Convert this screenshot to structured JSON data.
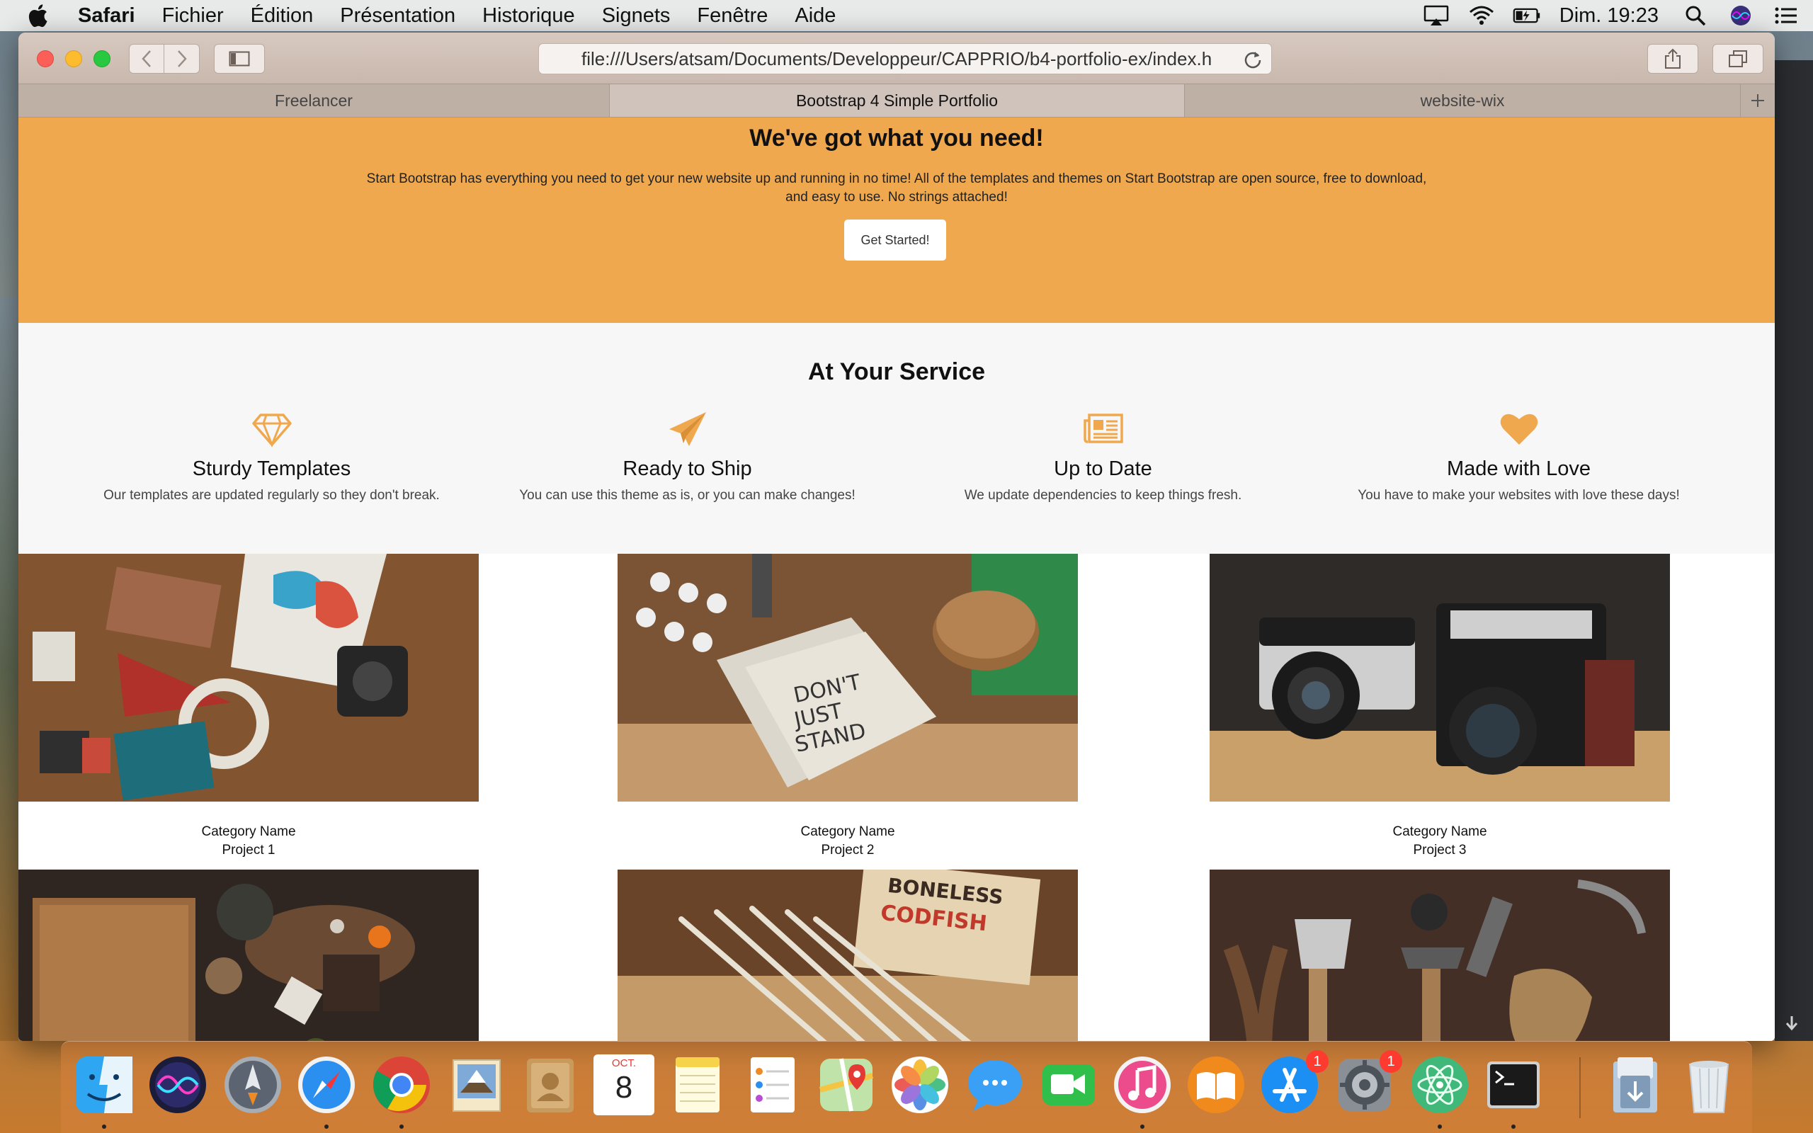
{
  "menubar": {
    "app_name": "Safari",
    "items": [
      "Fichier",
      "Édition",
      "Présentation",
      "Historique",
      "Signets",
      "Fenêtre",
      "Aide"
    ],
    "clock": "Dim. 19:23",
    "status_icons": [
      "airplay-icon",
      "wifi-icon",
      "battery-icon",
      "spotlight-icon",
      "siri-icon",
      "notification-center-icon"
    ]
  },
  "browser": {
    "url": "file:///Users/atsam/Documents/Developpeur/CAPPRIO/b4-portfolio-ex/index.h",
    "tabs": [
      {
        "label": "Freelancer",
        "active": false
      },
      {
        "label": "Bootstrap 4 Simple Portfolio",
        "active": true
      },
      {
        "label": "website-wix",
        "active": false
      }
    ]
  },
  "hero": {
    "title": "We've got what you need!",
    "text": "Start Bootstrap has everything you need to get your new website up and running in no time! All of the templates and themes on Start Bootstrap are open source, free to download, and easy to use. No strings attached!",
    "cta_label": "Get Started!",
    "bg_color": "#f0a84e"
  },
  "services": {
    "heading": "At Your Service",
    "accent_color": "#f0a84e",
    "items": [
      {
        "icon": "diamond-icon",
        "title": "Sturdy Templates",
        "desc": "Our templates are updated regularly so they don't break."
      },
      {
        "icon": "paper-plane-icon",
        "title": "Ready to Ship",
        "desc": "You can use this theme as is, or you can make changes!"
      },
      {
        "icon": "newspaper-icon",
        "title": "Up to Date",
        "desc": "We update dependencies to keep things fresh."
      },
      {
        "icon": "heart-icon",
        "title": "Made with Love",
        "desc": "You have to make your websites with love these days!"
      }
    ]
  },
  "portfolio": {
    "items": [
      {
        "category": "Category Name",
        "project": "Project 1"
      },
      {
        "category": "Category Name",
        "project": "Project 2"
      },
      {
        "category": "Category Name",
        "project": "Project 3"
      },
      {
        "category": "",
        "project": ""
      },
      {
        "category": "",
        "project": ""
      },
      {
        "category": "",
        "project": ""
      }
    ]
  },
  "dock": {
    "calendar_month": "OCT.",
    "calendar_day": "8",
    "badges": {
      "app_store": "1",
      "system_preferences": "1"
    },
    "apps": [
      "finder-icon",
      "siri-icon",
      "launchpad-icon",
      "safari-icon",
      "chrome-icon",
      "mail-icon",
      "contacts-icon",
      "calendar-icon",
      "notes-icon",
      "reminders-icon",
      "maps-icon",
      "photos-icon",
      "messages-icon",
      "facetime-icon",
      "itunes-icon",
      "books-icon",
      "app-store-icon",
      "system-preferences-icon",
      "atom-icon",
      "terminal-icon",
      "downloads-icon",
      "trash-icon"
    ]
  }
}
